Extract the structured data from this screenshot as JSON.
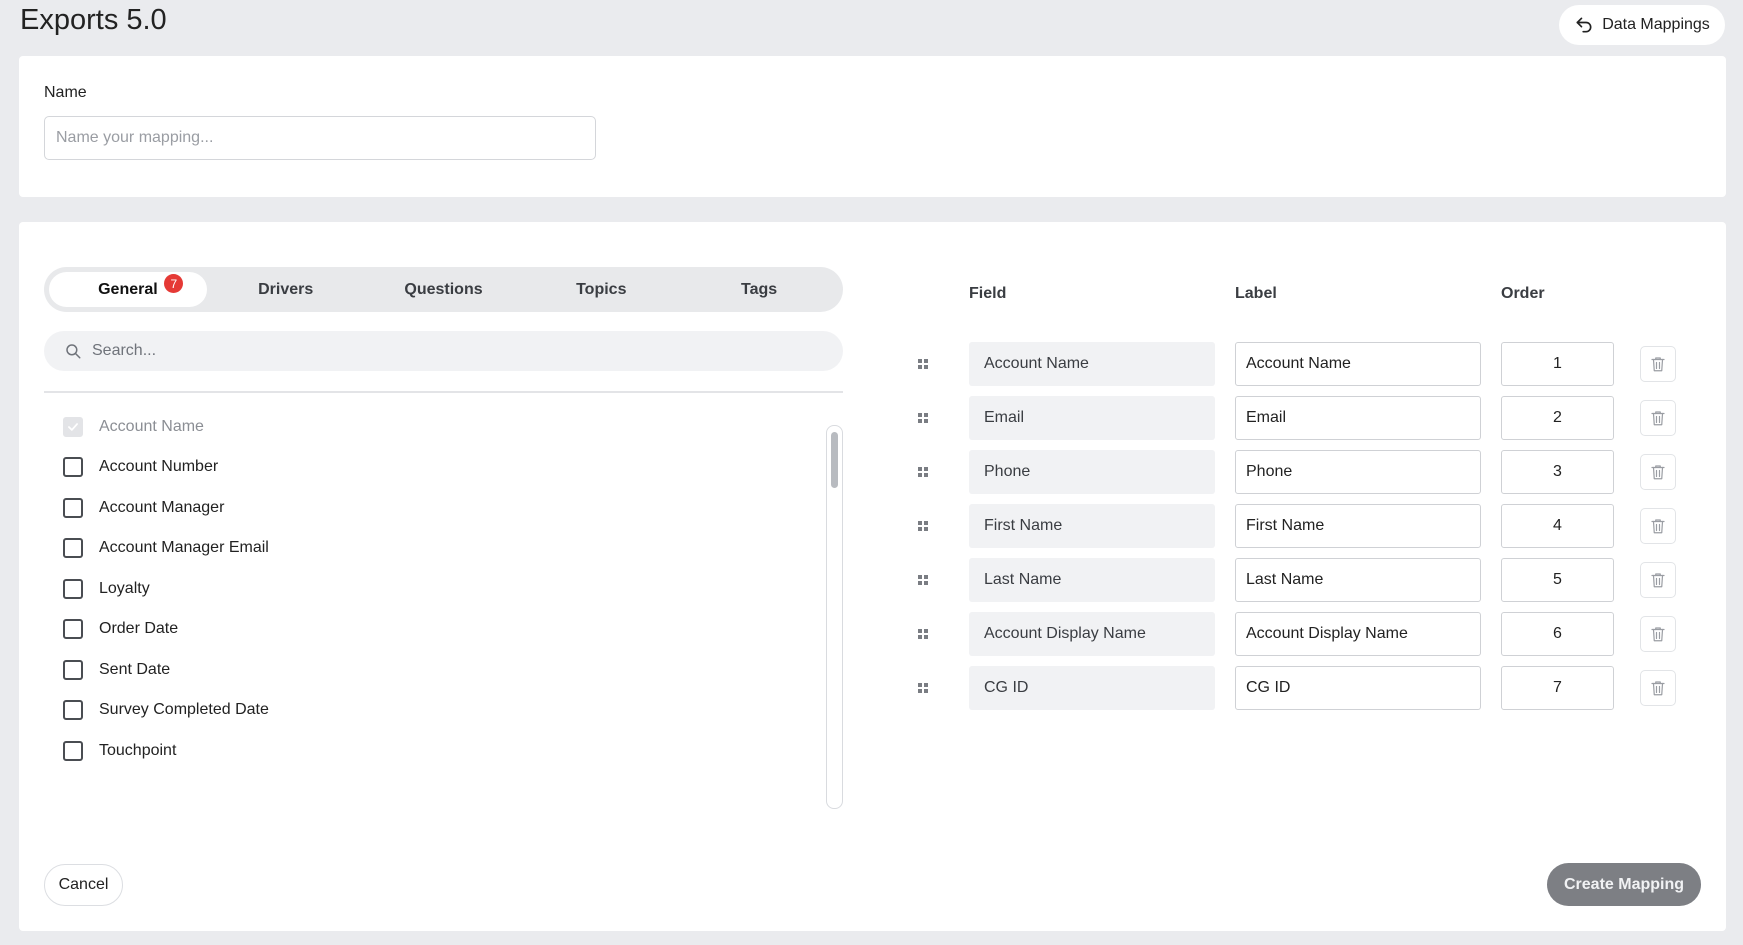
{
  "header": {
    "title": "Exports 5.0",
    "data_mappings_label": "Data Mappings"
  },
  "name_section": {
    "label": "Name",
    "placeholder": "Name your mapping...",
    "value": ""
  },
  "tabs": [
    {
      "label": "General",
      "badge": "7",
      "active": true
    },
    {
      "label": "Drivers"
    },
    {
      "label": "Questions"
    },
    {
      "label": "Topics"
    },
    {
      "label": "Tags"
    }
  ],
  "search": {
    "placeholder": "Search..."
  },
  "field_list": [
    {
      "label": "Account Name",
      "checked": true,
      "disabled": true
    },
    {
      "label": "Account Number",
      "checked": false
    },
    {
      "label": "Account Manager",
      "checked": false
    },
    {
      "label": "Account Manager Email",
      "checked": false
    },
    {
      "label": "Loyalty",
      "checked": false
    },
    {
      "label": "Order Date",
      "checked": false
    },
    {
      "label": "Sent Date",
      "checked": false
    },
    {
      "label": "Survey Completed Date",
      "checked": false
    },
    {
      "label": "Touchpoint",
      "checked": false
    }
  ],
  "mapping": {
    "headers": {
      "field": "Field",
      "label": "Label",
      "order": "Order"
    },
    "rows": [
      {
        "field": "Account Name",
        "label": "Account Name",
        "order": "1"
      },
      {
        "field": "Email",
        "label": "Email",
        "order": "2"
      },
      {
        "field": "Phone",
        "label": "Phone",
        "order": "3"
      },
      {
        "field": "First Name",
        "label": "First Name",
        "order": "4"
      },
      {
        "field": "Last Name",
        "label": "Last Name",
        "order": "5"
      },
      {
        "field": "Account Display Name",
        "label": "Account Display Name",
        "order": "6"
      },
      {
        "field": "CG ID",
        "label": "CG ID",
        "order": "7"
      }
    ]
  },
  "footer": {
    "cancel_label": "Cancel",
    "create_label": "Create Mapping"
  },
  "colors": {
    "background": "#eaebee",
    "badge": "#e53935",
    "primary_disabled": "#7d7f84"
  }
}
